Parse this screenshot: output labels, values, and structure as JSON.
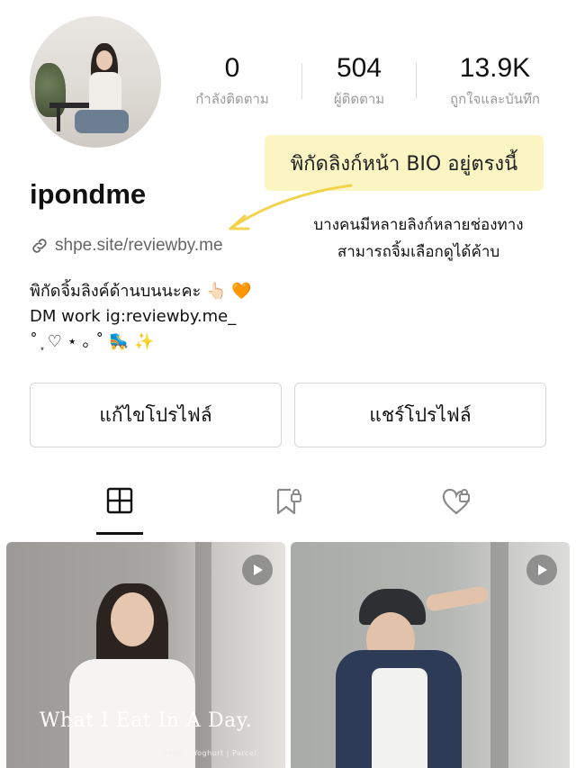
{
  "profile": {
    "username": "ipondme",
    "link": "shpe.site/reviewby.me",
    "bio_line1": "พิกัดจิ้มลิงค์ด้านบนนะคะ 👆🏻 🧡",
    "bio_line2": "DM work ig:reviewby.me_",
    "bio_line3_text": "˚ ͙ ♡ ⋆ ｡ ˚",
    "bio_line3_emoji1": "🛼",
    "bio_line3_emoji2": "✨"
  },
  "stats": [
    {
      "value": "0",
      "label": "กำลังติดตาม"
    },
    {
      "value": "504",
      "label": "ผู้ติดตาม"
    },
    {
      "value": "13.9K",
      "label": "ถูกใจและบันทึก"
    }
  ],
  "annotation": {
    "callout": "พิกัดลิงก์หน้า BIO อยู่ตรงนี้",
    "note_line1": "บางคนมีหลายลิงก์หลายช่องทาง",
    "note_line2": "สามารถจิ้มเลือกดูได้ค้าบ",
    "callout_color": "#fbf5c4",
    "arrow_color": "#f2d34a"
  },
  "buttons": {
    "edit_profile": "แก้ไขโปรไฟล์",
    "share_profile": "แชร์โปรไฟล์"
  },
  "tabs": [
    {
      "icon": "grid-icon",
      "active": true
    },
    {
      "icon": "bookmark-lock-icon",
      "active": false
    },
    {
      "icon": "heart-lock-icon",
      "active": false
    }
  ],
  "posts": [
    {
      "caption": "What I Eat In A Day.",
      "subcaption": "Bagel | Yoghurt | Parcel",
      "icon": "play-icon"
    },
    {
      "caption": "",
      "subcaption": "",
      "icon": "play-icon"
    }
  ]
}
